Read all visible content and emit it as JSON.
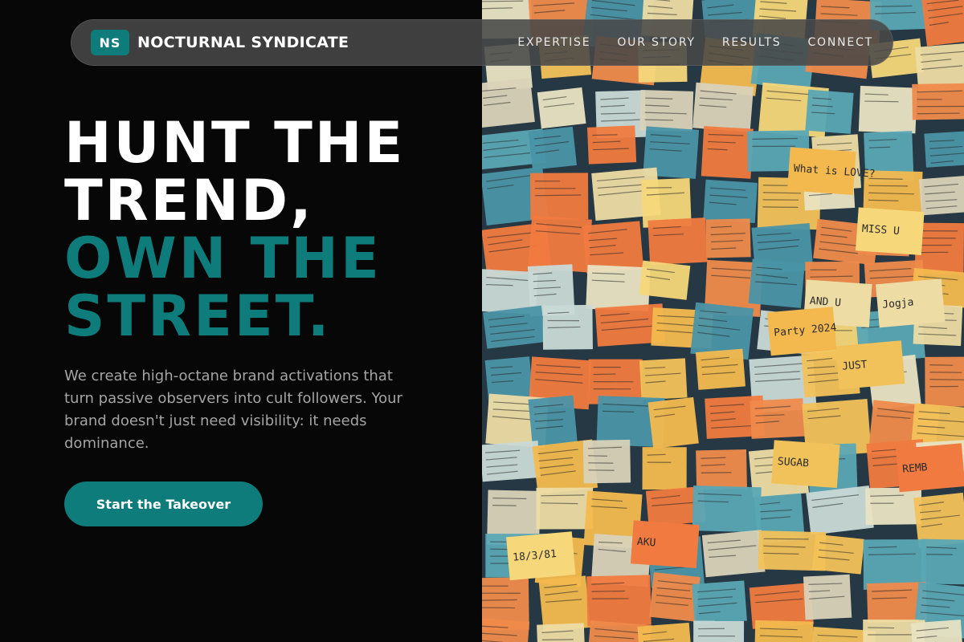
{
  "nav": {
    "logo_initials": "NS",
    "brand": "NOCTURNAL SYNDICATE",
    "links": [
      {
        "label": "EXPERTISE"
      },
      {
        "label": "OUR STORY"
      },
      {
        "label": "RESULTS"
      },
      {
        "label": "CONNECT"
      }
    ]
  },
  "hero": {
    "headline_line1": "HUNT THE",
    "headline_line2": "TREND,",
    "headline_line3": "OWN THE",
    "headline_line4": "STREET.",
    "description": "We create high-octane brand activations that turn passive observers into cult followers. Your brand doesn't just need visibility: it needs dominance.",
    "cta_label": "Start the Takeover"
  },
  "image": {
    "notes": [
      "MISS U",
      "JUST",
      "AKU",
      "Jogja",
      "What is LOVE?",
      "18/3/81",
      "SUGAB",
      "REMB",
      "AND U",
      "Party 2024"
    ]
  },
  "colors": {
    "accent": "#0e7c7b",
    "background": "#070707",
    "nav_bg": "#484848",
    "body_text": "#a4a4a4"
  }
}
